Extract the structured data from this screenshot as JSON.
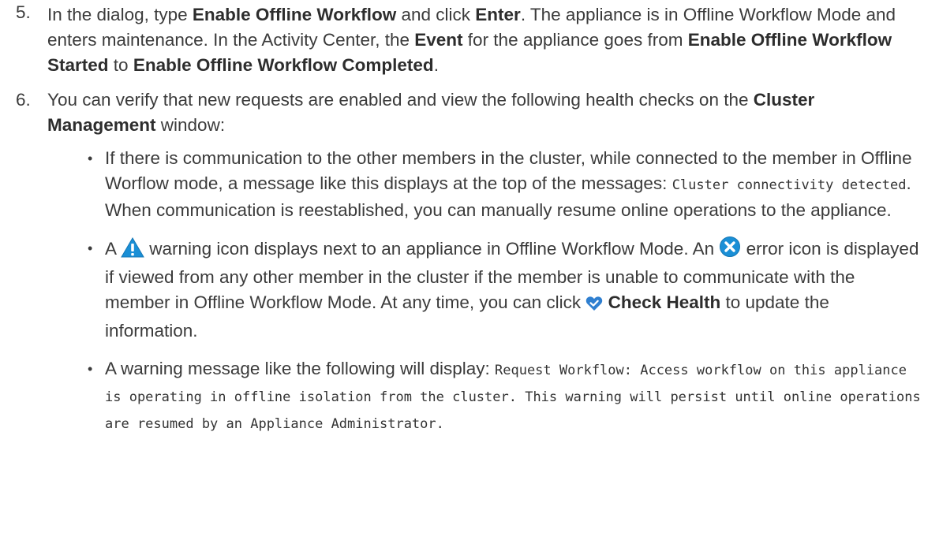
{
  "steps": [
    {
      "number": "5.",
      "parts": {
        "t1": "In the dialog, type ",
        "b1": "Enable Offline Workflow",
        "t2": " and click ",
        "b2": "Enter",
        "t3": ". The appliance is in Offline Workflow Mode and enters maintenance. In the Activity Center, the ",
        "b3": "Event",
        "t4": " for the appliance goes from ",
        "b4": "Enable Offline Workflow Started",
        "t5": " to ",
        "b5": "Enable Offline Workflow Completed",
        "t6": "."
      }
    },
    {
      "number": "6.",
      "parts": {
        "t1": "You can verify that new requests are enabled and view the following health checks on the ",
        "b1": "Cluster Management",
        "t2": " window:"
      },
      "bullets": [
        {
          "t1": "If there is communication to the other members in the cluster, while connected to the member in Offline Worflow mode, a message like this displays at the top of the messages: ",
          "code1": "Cluster connectivity detected",
          "t2": ". When communication is reestablished, you can manually resume online operations to the appliance."
        },
        {
          "t1": "A ",
          "icon1": "warning-triangle-icon",
          "t2": " warning icon displays next to an appliance in Offline Workflow Mode. An ",
          "icon2": "error-x-circle-icon",
          "t3": " error icon is displayed if viewed from any other member in the cluster if the member is unable to communicate with the member in Offline Workflow Mode. At any time, you can click ",
          "icon3": "heart-check-icon",
          "b1": "Check Health",
          "t4": " to update the information."
        },
        {
          "t1": "A warning message like the following will display: ",
          "code1": "Request Workflow: Access workflow on this appliance is operating in offline isolation from the cluster. This warning will persist until online operations are resumed by an Appliance Administrator."
        }
      ]
    }
  ],
  "colors": {
    "text": "#3b3b3b",
    "warning_icon": "#1a8fd6",
    "error_icon": "#1a8fd6",
    "health_icon": "#2f7fd0"
  }
}
